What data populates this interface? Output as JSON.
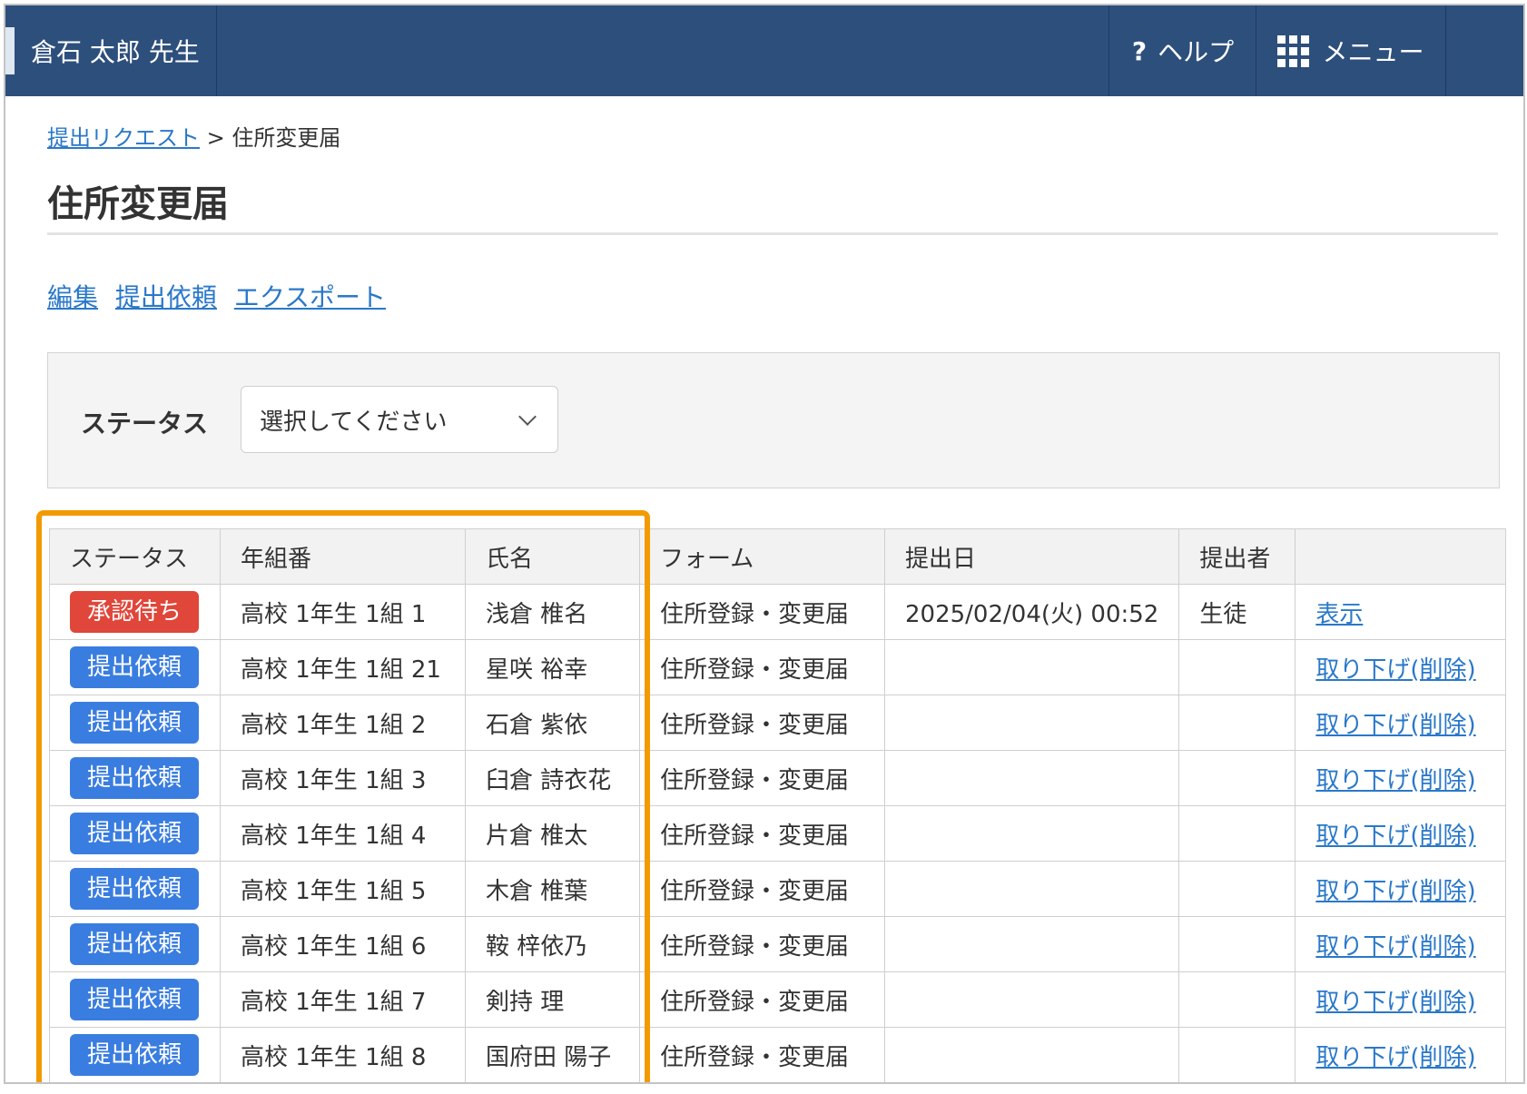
{
  "header": {
    "user_name": "倉石 太郎 先生",
    "help_label": "ヘルプ",
    "help_icon": "help-icon",
    "menu_label": "メニュー",
    "menu_icon": "grid-icon",
    "bg_color": "#2d4f7c"
  },
  "breadcrumb": {
    "parent": "提出リクエスト",
    "separator": ">",
    "current": "住所変更届"
  },
  "page_title": "住所変更届",
  "actions": [
    "編集",
    "提出依頼",
    "エクスポート"
  ],
  "filter": {
    "label": "ステータス",
    "select_value": "選択してください"
  },
  "table": {
    "headers": [
      "ステータス",
      "年組番",
      "氏名",
      "フォーム",
      "提出日",
      "提出者",
      ""
    ],
    "rows": [
      {
        "status": "承認待ち",
        "status_color": "#e0463a",
        "class": "高校 1年生 1組 1",
        "name": "浅倉 椎名",
        "form": "住所登録・変更届",
        "date": "2025/02/04(火) 00:52",
        "submitter": "生徒",
        "action": "表示"
      },
      {
        "status": "提出依頼",
        "status_color": "#3a7de0",
        "class": "高校 1年生 1組 21",
        "name": "星咲 裕幸",
        "form": "住所登録・変更届",
        "date": "",
        "submitter": "",
        "action": "取り下げ(削除)"
      },
      {
        "status": "提出依頼",
        "status_color": "#3a7de0",
        "class": "高校 1年生 1組 2",
        "name": "石倉 紫依",
        "form": "住所登録・変更届",
        "date": "",
        "submitter": "",
        "action": "取り下げ(削除)"
      },
      {
        "status": "提出依頼",
        "status_color": "#3a7de0",
        "class": "高校 1年生 1組 3",
        "name": "臼倉 詩衣花",
        "form": "住所登録・変更届",
        "date": "",
        "submitter": "",
        "action": "取り下げ(削除)"
      },
      {
        "status": "提出依頼",
        "status_color": "#3a7de0",
        "class": "高校 1年生 1組 4",
        "name": "片倉 椎太",
        "form": "住所登録・変更届",
        "date": "",
        "submitter": "",
        "action": "取り下げ(削除)"
      },
      {
        "status": "提出依頼",
        "status_color": "#3a7de0",
        "class": "高校 1年生 1組 5",
        "name": "木倉 椎葉",
        "form": "住所登録・変更届",
        "date": "",
        "submitter": "",
        "action": "取り下げ(削除)"
      },
      {
        "status": "提出依頼",
        "status_color": "#3a7de0",
        "class": "高校 1年生 1組 6",
        "name": "鞍 梓依乃",
        "form": "住所登録・変更届",
        "date": "",
        "submitter": "",
        "action": "取り下げ(削除)"
      },
      {
        "status": "提出依頼",
        "status_color": "#3a7de0",
        "class": "高校 1年生 1組 7",
        "name": "剣持 理",
        "form": "住所登録・変更届",
        "date": "",
        "submitter": "",
        "action": "取り下げ(削除)"
      },
      {
        "status": "提出依頼",
        "status_color": "#3a7de0",
        "class": "高校 1年生 1組 8",
        "name": "国府田 陽子",
        "form": "住所登録・変更届",
        "date": "",
        "submitter": "",
        "action": "取り下げ(削除)"
      }
    ]
  },
  "highlight_color": "#f29a00"
}
